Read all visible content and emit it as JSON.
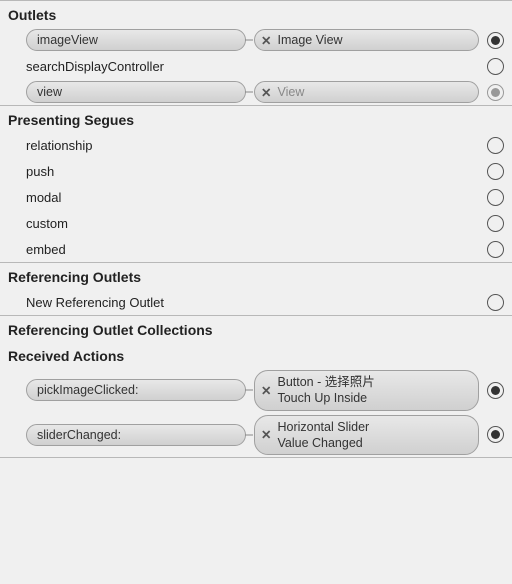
{
  "sections": {
    "outlets": {
      "title": "Outlets",
      "items": [
        {
          "left": "imageView",
          "right": "Image View",
          "filled": true,
          "dim": false
        },
        {
          "left": "searchDisplayController",
          "right": null,
          "filled": false
        },
        {
          "left": "view",
          "right": "View",
          "filled": true,
          "dim": true
        }
      ]
    },
    "presenting": {
      "title": "Presenting Segues",
      "items": [
        {
          "label": "relationship"
        },
        {
          "label": "push"
        },
        {
          "label": "modal"
        },
        {
          "label": "custom"
        },
        {
          "label": "embed"
        }
      ]
    },
    "refOutlets": {
      "title": "Referencing Outlets",
      "items": [
        {
          "label": "New Referencing Outlet"
        }
      ]
    },
    "refCollections": {
      "title": "Referencing Outlet Collections"
    },
    "received": {
      "title": "Received Actions",
      "items": [
        {
          "left": "pickImageClicked:",
          "rightLine1": "Button - 选择照片",
          "rightLine2": "Touch Up Inside"
        },
        {
          "left": "sliderChanged:",
          "rightLine1": "Horizontal Slider",
          "rightLine2": "Value Changed"
        }
      ]
    }
  }
}
